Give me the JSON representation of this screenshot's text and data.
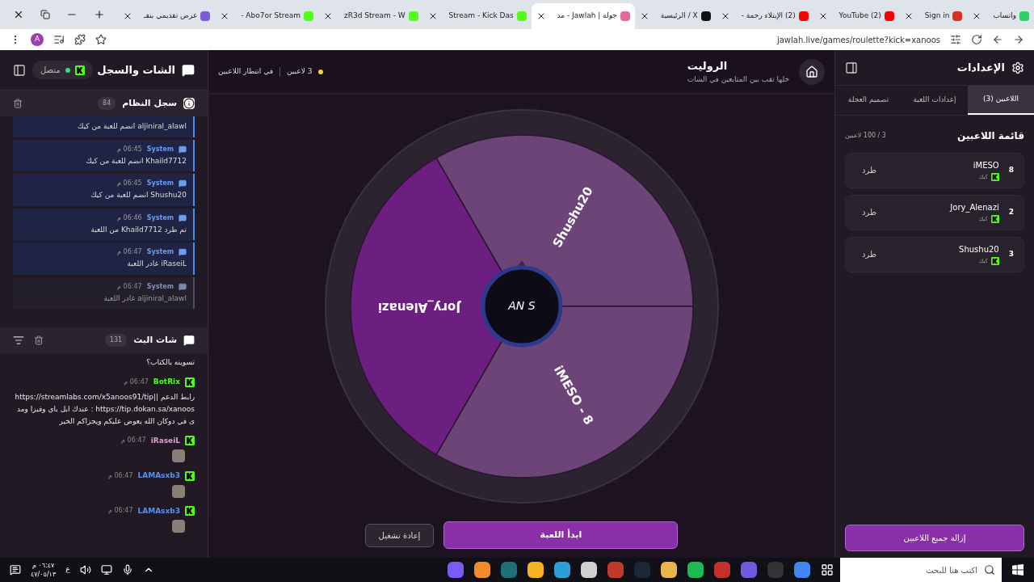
{
  "browser": {
    "tabs": [
      {
        "title": "واتساب",
        "selected": false,
        "color": "#25d366"
      },
      {
        "title": "Sign in",
        "selected": false,
        "color": "#d93025"
      },
      {
        "title": "(2) YouTube",
        "selected": false,
        "color": "#ff0000"
      },
      {
        "title": "(2) الإبتلاء رحمة -",
        "selected": false,
        "color": "#ff0000"
      },
      {
        "title": "X / الرئيسية",
        "selected": false,
        "color": "#111111"
      },
      {
        "title": "جولة | Jawlah - مد",
        "selected": true,
        "color": "#e26aa0"
      },
      {
        "title": "Stream - Kick Das",
        "selected": false,
        "color": "#53fc18"
      },
      {
        "title": "zR3d Stream - W",
        "selected": false,
        "color": "#53fc18"
      },
      {
        "title": "Abo7or Stream -",
        "selected": false,
        "color": "#53fc18"
      },
      {
        "title": "عرض تقديمي بنفـ",
        "selected": false,
        "color": "#7b5cd6"
      }
    ],
    "profile": "A",
    "url": "jawlah.live/games/roulette?kick=xanoos"
  },
  "chat_panel": {
    "title": "الشات والسجل",
    "status": "متصل",
    "system_log": {
      "title": "سجل النظام",
      "count": "84",
      "entries": [
        {
          "text": "aljiniral_alawl انضم للعبة من كيك",
          "dimmed": false
        },
        {
          "author": "System",
          "time": "06:45 م",
          "text": "Khaild7712 انضم للعبة من كيك",
          "dimmed": false
        },
        {
          "author": "System",
          "time": "06:45 م",
          "text": "Shushu20 انضم للعبة من كيك",
          "dimmed": false
        },
        {
          "author": "System",
          "time": "06:46 م",
          "text": "تم طرد Khaild7712 من اللعبة",
          "dimmed": false
        },
        {
          "author": "System",
          "time": "06:47 م",
          "text": "iRaseiL غادر اللعبة",
          "dimmed": false
        },
        {
          "author": "System",
          "time": "06:47 م",
          "text": "aljiniral_alawl غادر اللعبة",
          "dimmed": true
        }
      ]
    },
    "stream_chat": {
      "title": "شات البث",
      "count": "131",
      "messages": [
        {
          "text": "تسوينه بالكتاب؟"
        },
        {
          "user": "BotRix",
          "color": "#53fc18",
          "time": "06:47 م",
          "text": "رابط الدعم https://streamlabs.com/x5anoos91/tip|| : https://tip.dokan.sa/xanoos عندك ابل باي وفيزا ومدى في دوكان الله يعوض عليكم ويجزاكم الخير"
        },
        {
          "user": "iRaseiL",
          "color": "#e59ad6",
          "time": "06:47 م",
          "emote": true
        },
        {
          "user": "LAMAsxb3",
          "color": "#5b8ee6",
          "time": "06:47 م",
          "emote": true
        },
        {
          "user": "LAMAsxb3",
          "color": "#5b8ee6",
          "time": "06:47 م",
          "emote": true
        }
      ]
    }
  },
  "game": {
    "title": "الروليت",
    "subtitle": "خلها تقب بين المتابعين في الشات",
    "players_count": "3 لاعبين",
    "status": "في انتظار اللاعبين",
    "wheel": {
      "hub": "AN S",
      "segments": [
        {
          "label": "Shushu20",
          "color": "#6c4477"
        },
        {
          "label": "iMESO - 8",
          "color": "#6c4477"
        },
        {
          "label": "Jory_Alenazi",
          "color": "#6c1f80"
        }
      ]
    },
    "start_button": "ابدأ اللعبة",
    "restart_button": "إعادة تشغيل"
  },
  "settings_panel": {
    "title": "الإعدادات",
    "tabs": [
      {
        "label": "اللاعبين (3)",
        "selected": true
      },
      {
        "label": "إعدادات اللعبة",
        "selected": false
      },
      {
        "label": "تصميم العجلة",
        "selected": false
      }
    ],
    "list_title": "قائمة اللاعبين",
    "list_count": "3 / 100 لاعبين",
    "players": [
      {
        "number": "8",
        "name": "iMESO",
        "platform": "كيك",
        "action": "طرد"
      },
      {
        "number": "2",
        "name": "Jory_Alenazi",
        "platform": "كيك",
        "action": "طرد"
      },
      {
        "number": "3",
        "name": "Shushu20",
        "platform": "كيك",
        "action": "طرد"
      }
    ],
    "remove_all": "إزالة جميع اللاعبين"
  },
  "taskbar": {
    "time": "٠٦:٤٧ م",
    "date": "٤٧/٠٥/١٣",
    "language": "ع",
    "search_placeholder": "اكتب هنا للبحث",
    "apps": [
      {
        "color": "#7a5af8"
      },
      {
        "color": "#f28c28"
      },
      {
        "color": "#1f6f78"
      },
      {
        "color": "#f5b324"
      },
      {
        "color": "#2a9fd8"
      },
      {
        "color": "#d0d0d0"
      },
      {
        "color": "#c0392b"
      },
      {
        "color": "#1b2838"
      },
      {
        "color": "#e8b64c"
      },
      {
        "color": "#1db954"
      },
      {
        "color": "#c4302b"
      },
      {
        "color": "#6d5ce0"
      },
      {
        "color": "#333333"
      },
      {
        "color": "#4285f4"
      }
    ]
  }
}
